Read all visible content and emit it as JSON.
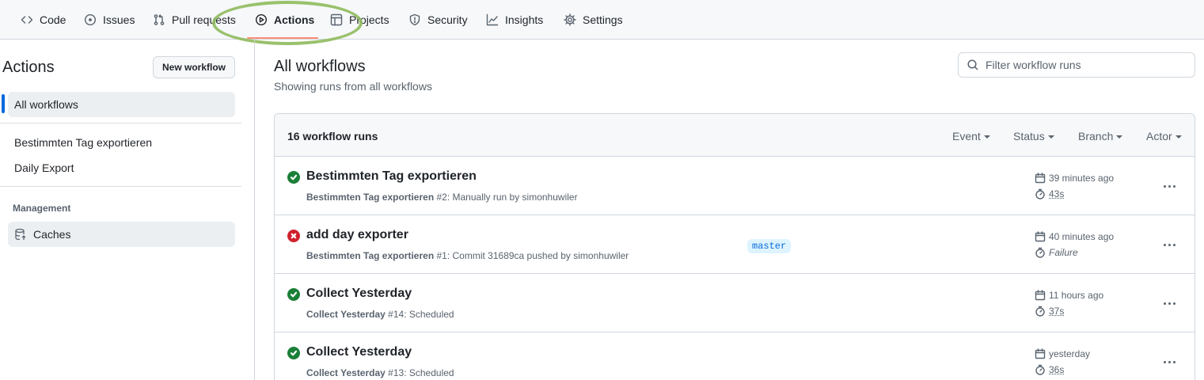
{
  "nav": {
    "tabs": [
      {
        "label": "Code",
        "icon": "code-icon"
      },
      {
        "label": "Issues",
        "icon": "issue-icon"
      },
      {
        "label": "Pull requests",
        "icon": "pull-request-icon"
      },
      {
        "label": "Actions",
        "icon": "play-icon",
        "active": true
      },
      {
        "label": "Projects",
        "icon": "table-icon"
      },
      {
        "label": "Security",
        "icon": "shield-icon"
      },
      {
        "label": "Insights",
        "icon": "graph-icon"
      },
      {
        "label": "Settings",
        "icon": "gear-icon"
      }
    ],
    "active_underline_color": "#fd8c73",
    "annotation_color": "#8fba5c"
  },
  "sidebar": {
    "title": "Actions",
    "new_workflow_label": "New workflow",
    "all_workflows_label": "All workflows",
    "workflows": [
      "Bestimmten Tag exportieren",
      "Daily Export"
    ],
    "management_heading": "Management",
    "caches_label": "Caches"
  },
  "main": {
    "title": "All workflows",
    "subtitle": "Showing runs from all workflows",
    "filter_placeholder": "Filter workflow runs",
    "runs_count": "16 workflow runs",
    "filters": [
      "Event",
      "Status",
      "Branch",
      "Actor"
    ],
    "runs": [
      {
        "status": "success",
        "title": "Bestimmten Tag exportieren",
        "workflow": "Bestimmten Tag exportieren",
        "detail": " #2: Manually run by simonhuwiler",
        "branch": "",
        "time": "39 minutes ago",
        "duration": "43s"
      },
      {
        "status": "failure",
        "title": "add day exporter",
        "workflow": "Bestimmten Tag exportieren",
        "detail": " #1: Commit 31689ca pushed by simonhuwiler",
        "branch": "master",
        "time": "40 minutes ago",
        "duration": "Failure"
      },
      {
        "status": "success",
        "title": "Collect Yesterday",
        "workflow": "Collect Yesterday",
        "detail": " #14: Scheduled",
        "branch": "",
        "time": "11 hours ago",
        "duration": "37s"
      },
      {
        "status": "success",
        "title": "Collect Yesterday",
        "workflow": "Collect Yesterday",
        "detail": " #13: Scheduled",
        "branch": "",
        "time": "yesterday",
        "duration": "36s"
      }
    ],
    "colors": {
      "success": "#1a7f37",
      "failure": "#cf222e",
      "branch_bg": "#ddf4ff",
      "branch_fg": "#0969da"
    }
  }
}
